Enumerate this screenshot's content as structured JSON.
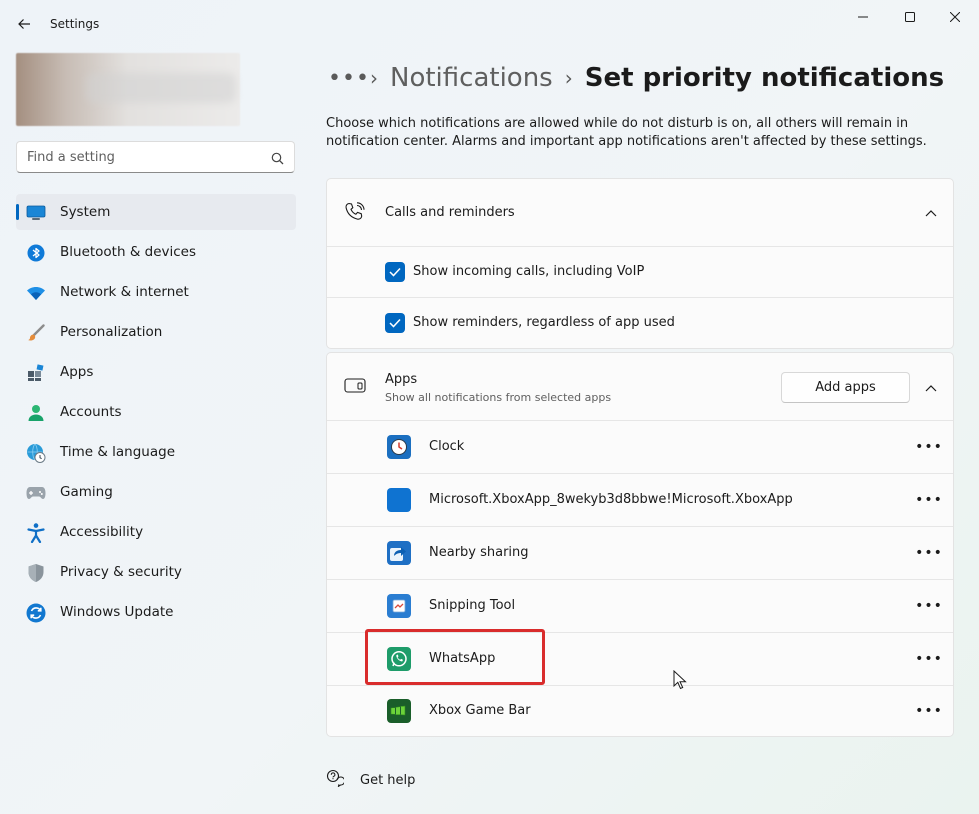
{
  "window": {
    "title": "Settings",
    "back_icon": "arrow-left-icon",
    "controls": [
      "minimize-icon",
      "maximize-icon",
      "close-icon"
    ]
  },
  "sidebar": {
    "search": {
      "placeholder": "Find a setting",
      "value": "",
      "icon": "search-icon"
    },
    "items": [
      {
        "label": "System",
        "icon": "system-icon",
        "active": true
      },
      {
        "label": "Bluetooth & devices",
        "icon": "bluetooth-icon"
      },
      {
        "label": "Network & internet",
        "icon": "wifi-icon"
      },
      {
        "label": "Personalization",
        "icon": "brush-icon"
      },
      {
        "label": "Apps",
        "icon": "apps-icon"
      },
      {
        "label": "Accounts",
        "icon": "person-icon"
      },
      {
        "label": "Time & language",
        "icon": "globe-clock-icon"
      },
      {
        "label": "Gaming",
        "icon": "gamepad-icon"
      },
      {
        "label": "Accessibility",
        "icon": "accessibility-icon"
      },
      {
        "label": "Privacy & security",
        "icon": "shield-icon"
      },
      {
        "label": "Windows Update",
        "icon": "update-icon"
      }
    ]
  },
  "breadcrumb": {
    "overflow": "•••",
    "separator": "›",
    "parent": "Notifications",
    "current": "Set priority notifications"
  },
  "description": "Choose which notifications are allowed while do not disturb is on, all others will remain in notification center. Alarms and important app notifications aren't affected by these settings.",
  "calls_section": {
    "title": "Calls and reminders",
    "icon": "phone-ringing-icon",
    "options": [
      {
        "label": "Show incoming calls, including VoIP",
        "checked": true
      },
      {
        "label": "Show reminders, regardless of app used",
        "checked": true
      }
    ]
  },
  "apps_section": {
    "title": "Apps",
    "subtitle": "Show all notifications from selected apps",
    "icon": "app-window-icon",
    "add_button": "Add apps",
    "more_label": "•••",
    "apps": [
      {
        "name": "Clock",
        "icon": "clock-app-icon"
      },
      {
        "name": "Microsoft.XboxApp_8wekyb3d8bbwe!Microsoft.XboxApp",
        "icon": "blue-tile-icon"
      },
      {
        "name": "Nearby sharing",
        "icon": "nearby-sharing-icon"
      },
      {
        "name": "Snipping Tool",
        "icon": "snipping-tool-icon"
      },
      {
        "name": "WhatsApp",
        "icon": "whatsapp-icon"
      },
      {
        "name": "Xbox Game Bar",
        "icon": "xbox-game-bar-icon"
      }
    ]
  },
  "help": {
    "label": "Get help",
    "icon": "help-chat-icon"
  },
  "colors": {
    "accent": "#0067c0",
    "highlight": "#d92c2c"
  }
}
